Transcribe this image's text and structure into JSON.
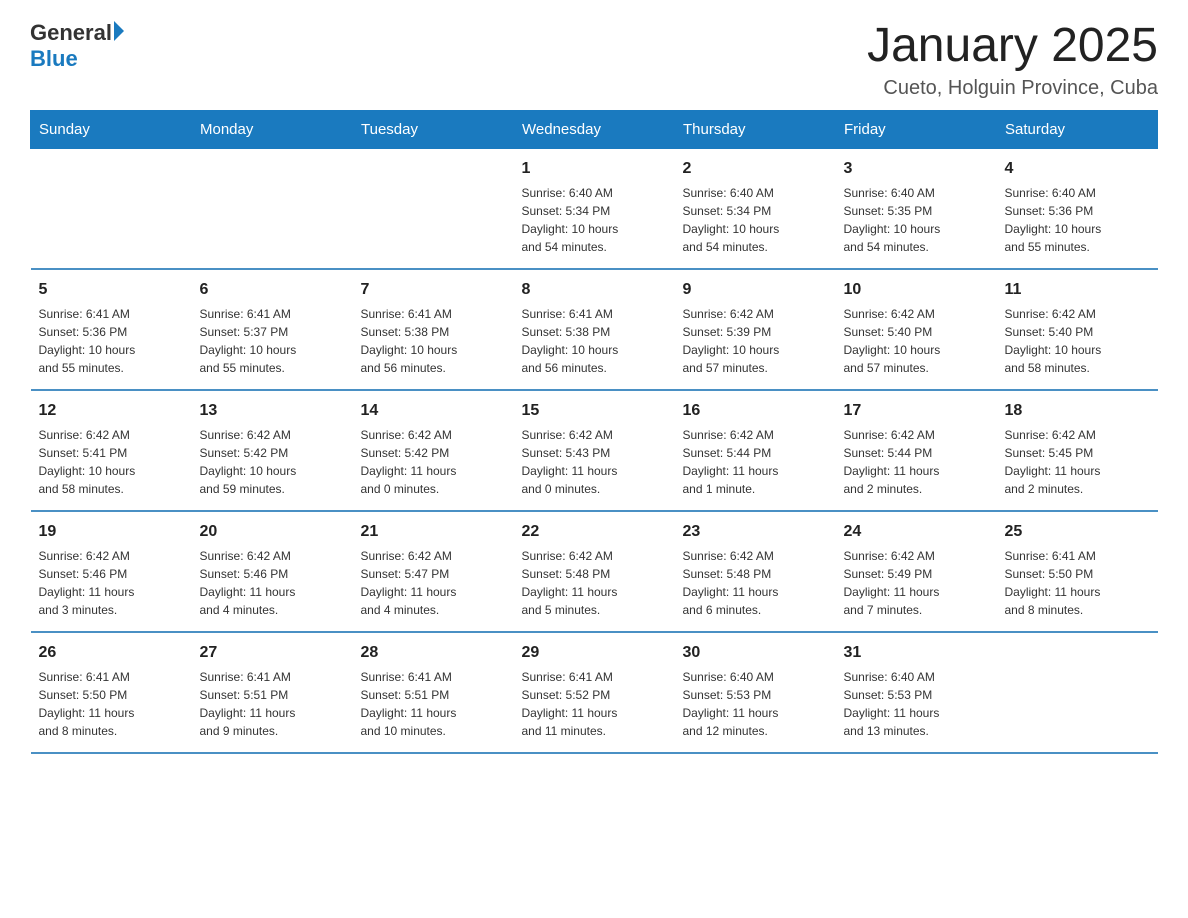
{
  "header": {
    "logo_general": "General",
    "logo_blue": "Blue",
    "title": "January 2025",
    "subtitle": "Cueto, Holguin Province, Cuba"
  },
  "calendar": {
    "days_of_week": [
      "Sunday",
      "Monday",
      "Tuesday",
      "Wednesday",
      "Thursday",
      "Friday",
      "Saturday"
    ],
    "weeks": [
      {
        "days": [
          {
            "number": "",
            "info": ""
          },
          {
            "number": "",
            "info": ""
          },
          {
            "number": "",
            "info": ""
          },
          {
            "number": "1",
            "info": "Sunrise: 6:40 AM\nSunset: 5:34 PM\nDaylight: 10 hours\nand 54 minutes."
          },
          {
            "number": "2",
            "info": "Sunrise: 6:40 AM\nSunset: 5:34 PM\nDaylight: 10 hours\nand 54 minutes."
          },
          {
            "number": "3",
            "info": "Sunrise: 6:40 AM\nSunset: 5:35 PM\nDaylight: 10 hours\nand 54 minutes."
          },
          {
            "number": "4",
            "info": "Sunrise: 6:40 AM\nSunset: 5:36 PM\nDaylight: 10 hours\nand 55 minutes."
          }
        ]
      },
      {
        "days": [
          {
            "number": "5",
            "info": "Sunrise: 6:41 AM\nSunset: 5:36 PM\nDaylight: 10 hours\nand 55 minutes."
          },
          {
            "number": "6",
            "info": "Sunrise: 6:41 AM\nSunset: 5:37 PM\nDaylight: 10 hours\nand 55 minutes."
          },
          {
            "number": "7",
            "info": "Sunrise: 6:41 AM\nSunset: 5:38 PM\nDaylight: 10 hours\nand 56 minutes."
          },
          {
            "number": "8",
            "info": "Sunrise: 6:41 AM\nSunset: 5:38 PM\nDaylight: 10 hours\nand 56 minutes."
          },
          {
            "number": "9",
            "info": "Sunrise: 6:42 AM\nSunset: 5:39 PM\nDaylight: 10 hours\nand 57 minutes."
          },
          {
            "number": "10",
            "info": "Sunrise: 6:42 AM\nSunset: 5:40 PM\nDaylight: 10 hours\nand 57 minutes."
          },
          {
            "number": "11",
            "info": "Sunrise: 6:42 AM\nSunset: 5:40 PM\nDaylight: 10 hours\nand 58 minutes."
          }
        ]
      },
      {
        "days": [
          {
            "number": "12",
            "info": "Sunrise: 6:42 AM\nSunset: 5:41 PM\nDaylight: 10 hours\nand 58 minutes."
          },
          {
            "number": "13",
            "info": "Sunrise: 6:42 AM\nSunset: 5:42 PM\nDaylight: 10 hours\nand 59 minutes."
          },
          {
            "number": "14",
            "info": "Sunrise: 6:42 AM\nSunset: 5:42 PM\nDaylight: 11 hours\nand 0 minutes."
          },
          {
            "number": "15",
            "info": "Sunrise: 6:42 AM\nSunset: 5:43 PM\nDaylight: 11 hours\nand 0 minutes."
          },
          {
            "number": "16",
            "info": "Sunrise: 6:42 AM\nSunset: 5:44 PM\nDaylight: 11 hours\nand 1 minute."
          },
          {
            "number": "17",
            "info": "Sunrise: 6:42 AM\nSunset: 5:44 PM\nDaylight: 11 hours\nand 2 minutes."
          },
          {
            "number": "18",
            "info": "Sunrise: 6:42 AM\nSunset: 5:45 PM\nDaylight: 11 hours\nand 2 minutes."
          }
        ]
      },
      {
        "days": [
          {
            "number": "19",
            "info": "Sunrise: 6:42 AM\nSunset: 5:46 PM\nDaylight: 11 hours\nand 3 minutes."
          },
          {
            "number": "20",
            "info": "Sunrise: 6:42 AM\nSunset: 5:46 PM\nDaylight: 11 hours\nand 4 minutes."
          },
          {
            "number": "21",
            "info": "Sunrise: 6:42 AM\nSunset: 5:47 PM\nDaylight: 11 hours\nand 4 minutes."
          },
          {
            "number": "22",
            "info": "Sunrise: 6:42 AM\nSunset: 5:48 PM\nDaylight: 11 hours\nand 5 minutes."
          },
          {
            "number": "23",
            "info": "Sunrise: 6:42 AM\nSunset: 5:48 PM\nDaylight: 11 hours\nand 6 minutes."
          },
          {
            "number": "24",
            "info": "Sunrise: 6:42 AM\nSunset: 5:49 PM\nDaylight: 11 hours\nand 7 minutes."
          },
          {
            "number": "25",
            "info": "Sunrise: 6:41 AM\nSunset: 5:50 PM\nDaylight: 11 hours\nand 8 minutes."
          }
        ]
      },
      {
        "days": [
          {
            "number": "26",
            "info": "Sunrise: 6:41 AM\nSunset: 5:50 PM\nDaylight: 11 hours\nand 8 minutes."
          },
          {
            "number": "27",
            "info": "Sunrise: 6:41 AM\nSunset: 5:51 PM\nDaylight: 11 hours\nand 9 minutes."
          },
          {
            "number": "28",
            "info": "Sunrise: 6:41 AM\nSunset: 5:51 PM\nDaylight: 11 hours\nand 10 minutes."
          },
          {
            "number": "29",
            "info": "Sunrise: 6:41 AM\nSunset: 5:52 PM\nDaylight: 11 hours\nand 11 minutes."
          },
          {
            "number": "30",
            "info": "Sunrise: 6:40 AM\nSunset: 5:53 PM\nDaylight: 11 hours\nand 12 minutes."
          },
          {
            "number": "31",
            "info": "Sunrise: 6:40 AM\nSunset: 5:53 PM\nDaylight: 11 hours\nand 13 minutes."
          },
          {
            "number": "",
            "info": ""
          }
        ]
      }
    ]
  }
}
